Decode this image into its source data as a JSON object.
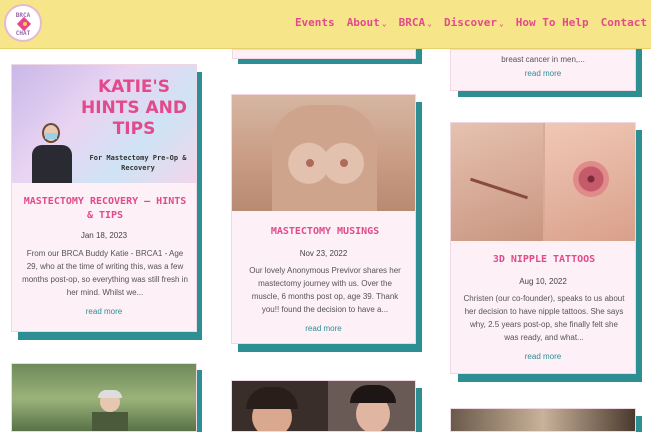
{
  "logo": {
    "line1": "BRCA",
    "line2": "CHAT"
  },
  "nav": {
    "events": "Events",
    "about": "About",
    "brca": "BRCA",
    "discover": "Discover",
    "how_to_help": "How To Help",
    "contact": "Contact"
  },
  "top_right_card": {
    "excerpt": "breast cancer in men,...",
    "read_more": "read more"
  },
  "cards": [
    {
      "image_heading": "KATIE'S HINTS AND TIPS",
      "image_sub": "For Mastectomy Pre-Op & Recovery",
      "title": "MASTECTOMY RECOVERY – HINTS & TIPS",
      "date": "Jan 18, 2023",
      "excerpt": "From our BRCA Buddy Katie - BRCA1 - Age 29, who at the time of writing this, was a few months post-op, so everything was still fresh in her mind. Whilst we...",
      "read_more": "read more"
    },
    {
      "title": "MASTECTOMY MUSINGS",
      "date": "Nov 23, 2022",
      "excerpt": "Our lovely Anonymous Previvor shares her mastectomy journey with us. Over the muscle, 6 months post op, age 39. Thank you!! found the decision to have a...",
      "read_more": "read more"
    },
    {
      "title": "3D NIPPLE TATTOOS",
      "date": "Aug 10, 2022",
      "excerpt": "Christen (our co-founder), speaks to us about her decision to have nipple tattoos. She says why, 2.5 years post-op, she finally felt she was ready, and what...",
      "read_more": "read more"
    }
  ]
}
